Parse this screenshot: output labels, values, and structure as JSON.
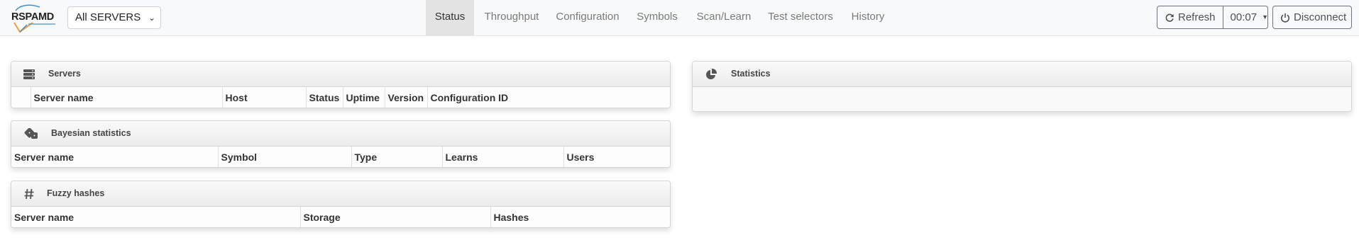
{
  "logo": {
    "text": "RSPAMD"
  },
  "server_select": {
    "value": "All SERVERS"
  },
  "nav": {
    "tabs": [
      {
        "label": "Status",
        "active": true
      },
      {
        "label": "Throughput"
      },
      {
        "label": "Configuration"
      },
      {
        "label": "Symbols"
      },
      {
        "label": "Scan/Learn"
      },
      {
        "label": "Test selectors"
      },
      {
        "label": "History"
      }
    ]
  },
  "toolbar": {
    "refresh_label": "Refresh",
    "timer_label": "00:07",
    "disconnect_label": "Disconnect"
  },
  "servers_card": {
    "title": "Servers",
    "columns": [
      "",
      "Server name",
      "Host",
      "Status",
      "Uptime",
      "Version",
      "Configuration ID"
    ]
  },
  "bayes_card": {
    "title": "Bayesian statistics",
    "columns": [
      "Server name",
      "Symbol",
      "Type",
      "Learns",
      "Users"
    ]
  },
  "fuzzy_card": {
    "title": "Fuzzy hashes",
    "columns": [
      "Server name",
      "Storage",
      "Hashes"
    ]
  },
  "stats_card": {
    "title": "Statistics"
  },
  "icons": {
    "servers": "server-icon",
    "bayes": "dice-icon",
    "fuzzy": "hashtag-icon",
    "stats": "pie-chart-icon",
    "refresh": "refresh-icon",
    "disconnect": "power-icon"
  }
}
